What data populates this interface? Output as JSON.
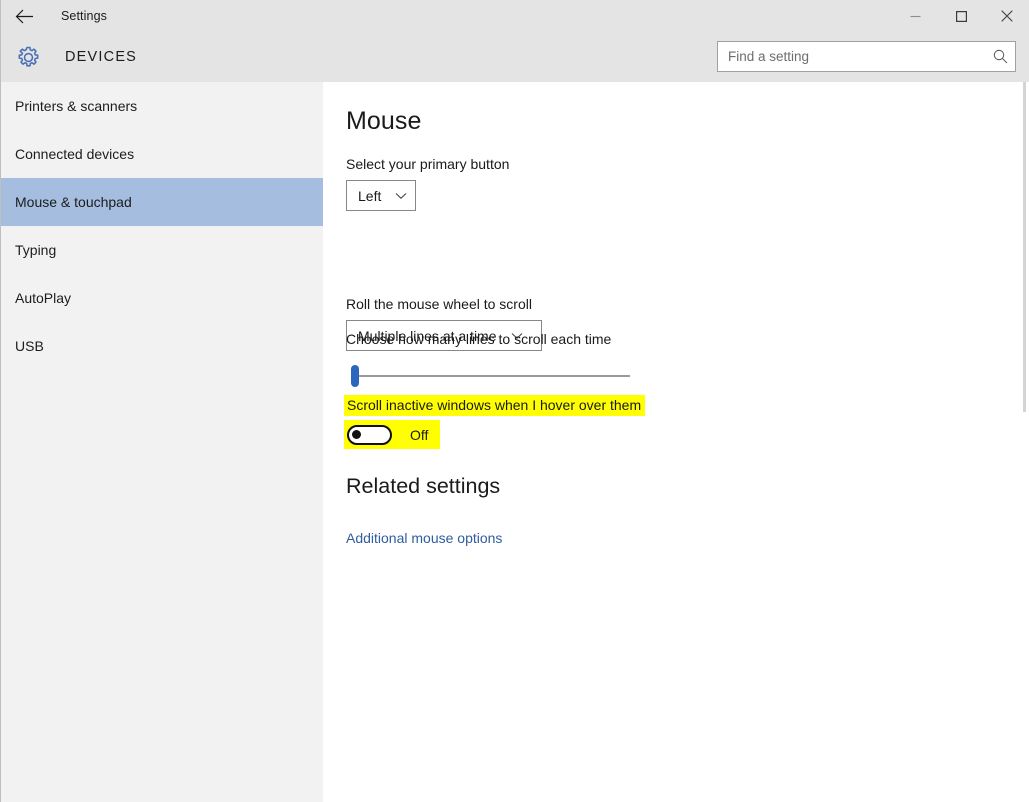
{
  "window": {
    "title": "Settings",
    "back_icon": "back-arrow-icon",
    "minimize_label": "Minimize",
    "maximize_label": "Maximize",
    "close_label": "Close"
  },
  "header": {
    "icon": "gear-icon",
    "title": "DEVICES",
    "search": {
      "placeholder": "Find a setting",
      "value": "",
      "icon": "search-icon"
    }
  },
  "sidebar": {
    "items": [
      {
        "label": "Printers & scanners",
        "selected": false
      },
      {
        "label": "Connected devices",
        "selected": false
      },
      {
        "label": "Mouse & touchpad",
        "selected": true
      },
      {
        "label": "Typing",
        "selected": false
      },
      {
        "label": "AutoPlay",
        "selected": false
      },
      {
        "label": "USB",
        "selected": false
      }
    ],
    "selected_color": "#a5bee0",
    "background": "#f2f2f2"
  },
  "main": {
    "page_title": "Mouse",
    "primary_button": {
      "label": "Select your primary button",
      "value": "Left",
      "chevron": "chevron-down-icon"
    },
    "wheel_scroll": {
      "label": "Roll the mouse wheel to scroll",
      "value": "Multiple lines at a time",
      "chevron": "chevron-down-icon"
    },
    "lines_slider": {
      "label": "Choose how many lines to scroll each time",
      "value": 1,
      "min": 1,
      "max": 100,
      "accent": "#2a66bb"
    },
    "inactive_scroll": {
      "label": "Scroll inactive windows when I hover over them",
      "state": "Off",
      "highlight_color": "#ffff00"
    },
    "related": {
      "heading": "Related settings",
      "link": "Additional mouse options",
      "link_color": "#2f5d9e"
    }
  }
}
